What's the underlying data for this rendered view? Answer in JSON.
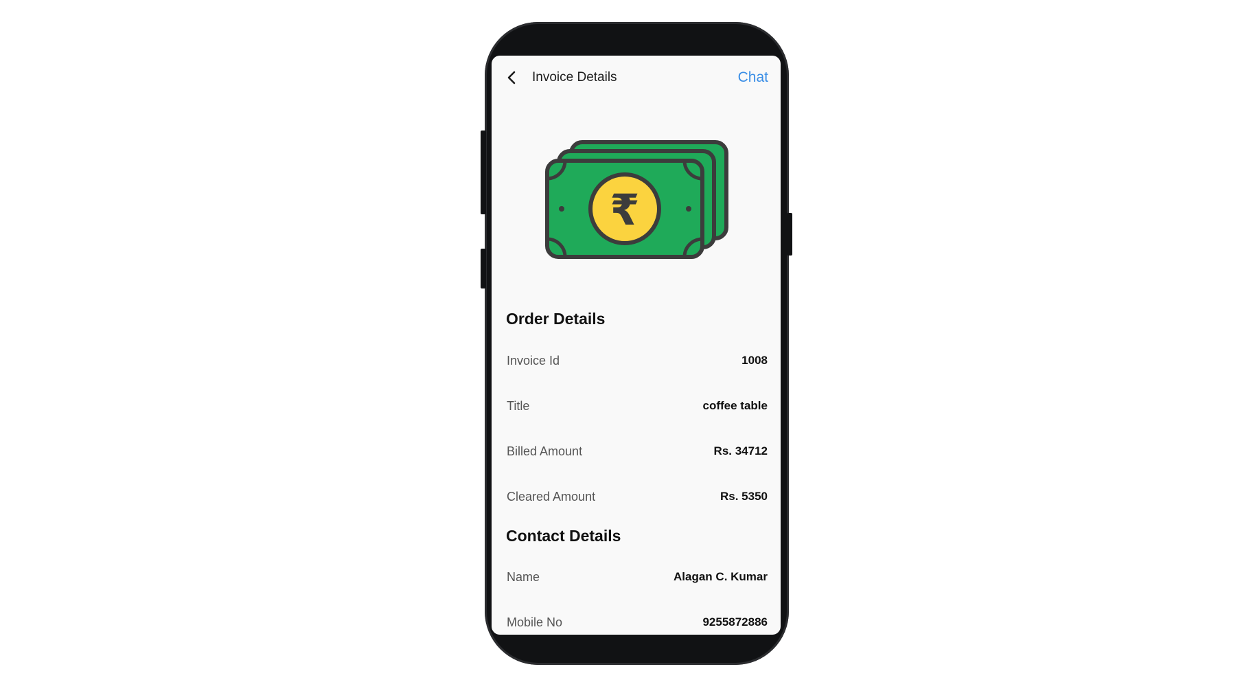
{
  "header": {
    "back_icon": "back-chevron-icon",
    "title": "Invoice Details",
    "chat_label": "Chat"
  },
  "illustration": {
    "icon": "rupee-cash-icon",
    "symbol": "₹",
    "colors": {
      "note_green": "#1faa59",
      "outline": "#3c3c3c",
      "coin_yellow": "#fbd33f"
    }
  },
  "colors": {
    "accent": "#3a8ee6",
    "screen_bg": "#f9f9f9"
  },
  "order_details": {
    "heading": "Order Details",
    "rows": [
      {
        "label": "Invoice Id",
        "value": "1008"
      },
      {
        "label": "Title",
        "value": "coffee table"
      },
      {
        "label": "Billed Amount",
        "value": "Rs. 34712"
      },
      {
        "label": "Cleared Amount",
        "value": "Rs. 5350"
      }
    ]
  },
  "contact_details": {
    "heading": "Contact Details",
    "rows": [
      {
        "label": "Name",
        "value": "Alagan C. Kumar"
      },
      {
        "label": "Mobile No",
        "value": "9255872886"
      }
    ]
  }
}
